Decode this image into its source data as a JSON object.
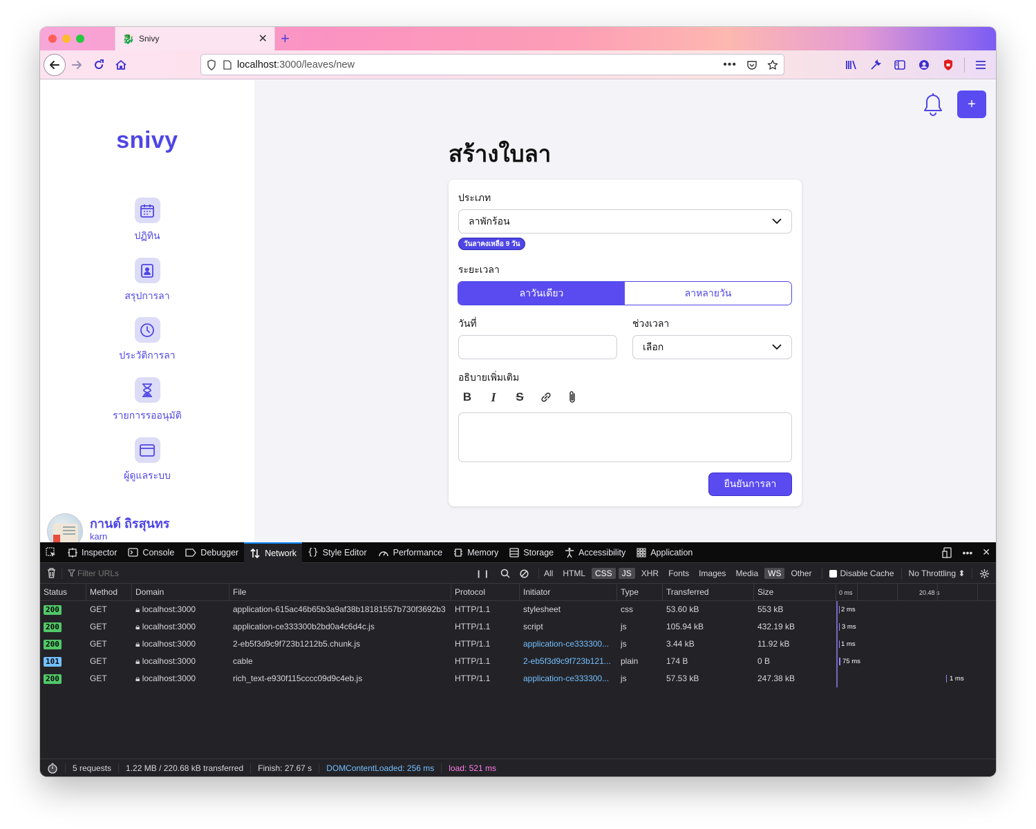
{
  "browser": {
    "tab_title": "Snivy",
    "url_host": "localhost",
    "url_path": ":3000/leaves/new"
  },
  "sidebar": {
    "logo": "snivy",
    "items": [
      {
        "label": "ปฏิทิน",
        "icon": "calendar-icon"
      },
      {
        "label": "สรุปการลา",
        "icon": "user-card-icon"
      },
      {
        "label": "ประวัติการลา",
        "icon": "clock-icon"
      },
      {
        "label": "รายการรออนุมัติ",
        "icon": "hourglass-icon"
      },
      {
        "label": "ผู้ดูแลระบบ",
        "icon": "window-icon"
      }
    ],
    "user": {
      "name": "กานต์ ถิรสุนทร",
      "handle": "karn"
    }
  },
  "page": {
    "title": "สร้างใบลา",
    "type_label": "ประเภท",
    "type_value": "ลาพักร้อน",
    "remaining_badge": "วันลาคงเหลือ 9 วัน",
    "duration_label": "ระยะเวลา",
    "duration_options": [
      "ลาวันเดียว",
      "ลาหลายวัน"
    ],
    "date_label": "วันที่",
    "date_value": "",
    "period_label": "ช่วงเวลา",
    "period_value": "เลือก",
    "description_label": "อธิบายเพิ่มเติม",
    "submit_label": "ยืนยันการลา"
  },
  "devtools": {
    "tabs": [
      "Inspector",
      "Console",
      "Debugger",
      "Network",
      "Style Editor",
      "Performance",
      "Memory",
      "Storage",
      "Accessibility",
      "Application"
    ],
    "active_tab": "Network",
    "filter_placeholder": "Filter URLs",
    "type_filters": [
      "All",
      "HTML",
      "CSS",
      "JS",
      "XHR",
      "Fonts",
      "Images",
      "Media",
      "WS",
      "Other"
    ],
    "selected_filters": [
      "CSS",
      "JS",
      "WS"
    ],
    "disable_cache": "Disable Cache",
    "throttling": "No Throttling ⬍",
    "columns": [
      "Status",
      "Method",
      "Domain",
      "File",
      "Protocol",
      "Initiator",
      "Type",
      "Transferred",
      "Size"
    ],
    "waterfall_ticks": [
      "0 ms",
      "20.48 s"
    ],
    "requests": [
      {
        "status": "200",
        "method": "GET",
        "domain": "localhost:3000",
        "file": "application-615ac46b65b3a9af38b18181557b730f3692b3",
        "protocol": "HTTP/1.1",
        "initiator": "stylesheet",
        "initiator_link": false,
        "type": "css",
        "transferred": "53.60 kB",
        "size": "553 kB",
        "timing": "2 ms"
      },
      {
        "status": "200",
        "method": "GET",
        "domain": "localhost:3000",
        "file": "application-ce333300b2bd0a4c6d4c.js",
        "protocol": "HTTP/1.1",
        "initiator": "script",
        "initiator_link": false,
        "type": "js",
        "transferred": "105.94 kB",
        "size": "432.19 kB",
        "timing": "3 ms"
      },
      {
        "status": "200",
        "method": "GET",
        "domain": "localhost:3000",
        "file": "2-eb5f3d9c9f723b1212b5.chunk.js",
        "protocol": "HTTP/1.1",
        "initiator": "application-ce333300...",
        "initiator_link": true,
        "type": "js",
        "transferred": "3.44 kB",
        "size": "11.92 kB",
        "timing": "1 ms"
      },
      {
        "status": "101",
        "method": "GET",
        "domain": "localhost:3000",
        "file": "cable",
        "protocol": "HTTP/1.1",
        "initiator": "2-eb5f3d9c9f723b121...",
        "initiator_link": true,
        "type": "plain",
        "transferred": "174 B",
        "size": "0 B",
        "timing": "75 ms"
      },
      {
        "status": "200",
        "method": "GET",
        "domain": "localhost:3000",
        "file": "rich_text-e930f115cccc09d9c4eb.js",
        "protocol": "HTTP/1.1",
        "initiator": "application-ce333300...",
        "initiator_link": true,
        "type": "js",
        "transferred": "57.53 kB",
        "size": "247.38 kB",
        "timing": "1 ms"
      }
    ],
    "summary": {
      "requests": "5 requests",
      "transferred": "1.22 MB / 220.68 kB transferred",
      "finish": "Finish: 27.67 s",
      "dom_loaded": "DOMContentLoaded: 256 ms",
      "load": "load: 521 ms"
    }
  },
  "colors": {
    "accent": "#4f46e5",
    "button": "#5a4bf0",
    "status_ok": "#51c868",
    "status_switch": "#75bfff"
  }
}
